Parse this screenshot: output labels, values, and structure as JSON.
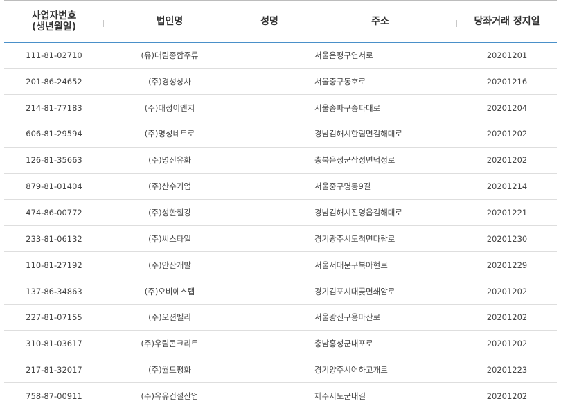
{
  "header": {
    "brn_line1": "사업자번호",
    "brn_line2": "(생년월일)",
    "corp": "법인명",
    "name": "성명",
    "address": "주소",
    "stop_date": "당좌거래 정지일"
  },
  "rows": [
    {
      "brn": "111-81-02710",
      "corp": "(유)대림종합주류",
      "name": "",
      "address": "서울은평구연서로",
      "date": "20201201"
    },
    {
      "brn": "201-86-24652",
      "corp": "(주)경성상사",
      "name": "",
      "address": "서울중구동호로",
      "date": "20201216"
    },
    {
      "brn": "214-81-77183",
      "corp": "(주)대성이엔지",
      "name": "",
      "address": "서울송파구송파대로",
      "date": "20201204"
    },
    {
      "brn": "606-81-29594",
      "corp": "(주)명성네트로",
      "name": "",
      "address": "경남김해시한림면김해대로",
      "date": "20201202"
    },
    {
      "brn": "126-81-35663",
      "corp": "(주)명신유화",
      "name": "",
      "address": "충북음성군삼성면덕정로",
      "date": "20201202"
    },
    {
      "brn": "879-81-01404",
      "corp": "(주)산수기업",
      "name": "",
      "address": "서울중구명동9길",
      "date": "20201214"
    },
    {
      "brn": "474-86-00772",
      "corp": "(주)성한철강",
      "name": "",
      "address": "경남김해시진영읍김해대로",
      "date": "20201221"
    },
    {
      "brn": "233-81-06132",
      "corp": "(주)씨스타일",
      "name": "",
      "address": "경기광주시도척면다람로",
      "date": "20201230"
    },
    {
      "brn": "110-81-27192",
      "corp": "(주)안산개발",
      "name": "",
      "address": "서울서대문구북아현로",
      "date": "20201229"
    },
    {
      "brn": "137-86-34863",
      "corp": "(주)오비에스랩",
      "name": "",
      "address": "경기김포시대곶면쇄암로",
      "date": "20201202"
    },
    {
      "brn": "227-81-07155",
      "corp": "(주)오션벨리",
      "name": "",
      "address": "서울광진구용마산로",
      "date": "20201202"
    },
    {
      "brn": "310-81-03617",
      "corp": "(주)우림콘크리트",
      "name": "",
      "address": "충남홍성군내포로",
      "date": "20201202"
    },
    {
      "brn": "217-81-32017",
      "corp": "(주)월드평화",
      "name": "",
      "address": "경기양주시어하고개로",
      "date": "20201223"
    },
    {
      "brn": "758-87-00911",
      "corp": "(주)유유건설산업",
      "name": "",
      "address": "제주시도군내길",
      "date": "20201202"
    }
  ]
}
